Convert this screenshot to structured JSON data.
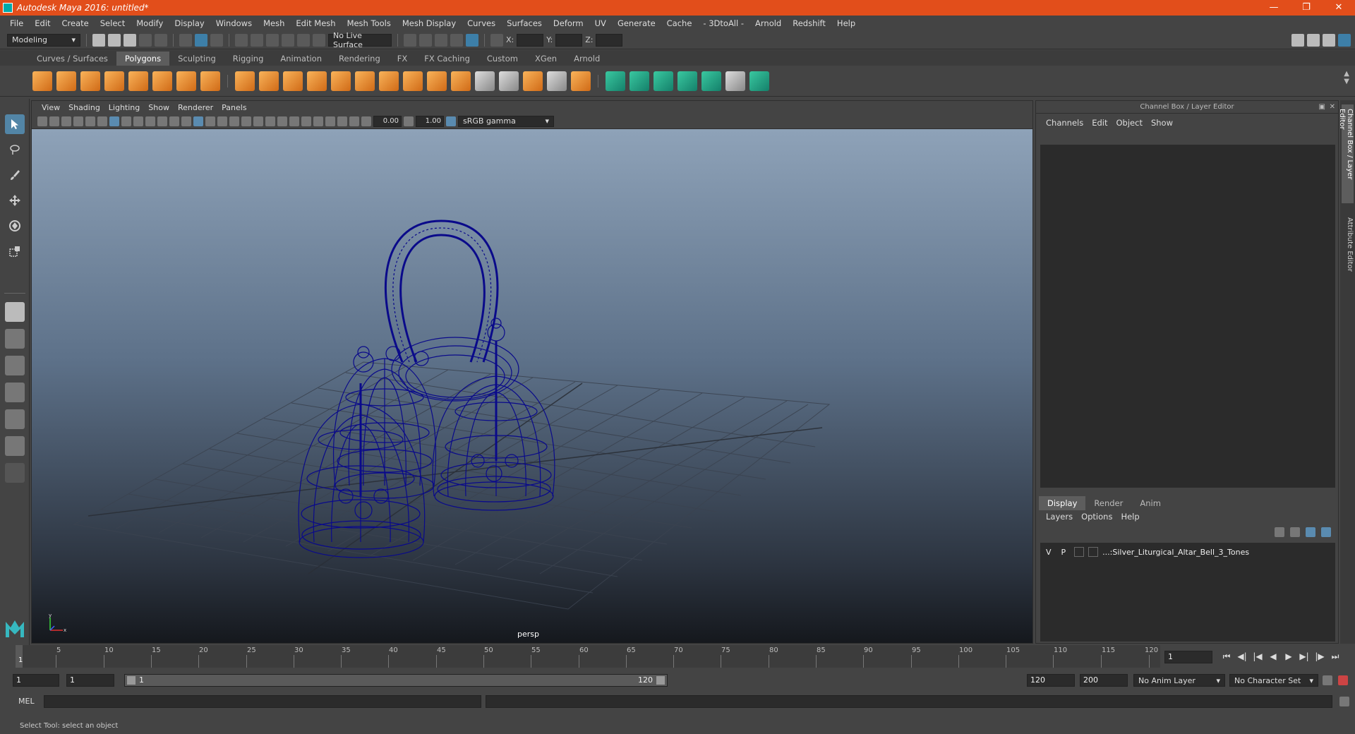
{
  "window": {
    "title": "Autodesk Maya 2016: untitled*"
  },
  "menubar": [
    "File",
    "Edit",
    "Create",
    "Select",
    "Modify",
    "Display",
    "Windows",
    "Mesh",
    "Edit Mesh",
    "Mesh Tools",
    "Mesh Display",
    "Curves",
    "Surfaces",
    "Deform",
    "UV",
    "Generate",
    "Cache",
    "- 3DtoAll -",
    "Arnold",
    "Redshift",
    "Help"
  ],
  "statusline": {
    "menuset": "Modeling",
    "live_surface": "No Live Surface",
    "x_label": "X:",
    "y_label": "Y:",
    "z_label": "Z:"
  },
  "shelf_tabs": [
    {
      "label": "Curves / Surfaces",
      "active": false
    },
    {
      "label": "Polygons",
      "active": true
    },
    {
      "label": "Sculpting",
      "active": false
    },
    {
      "label": "Rigging",
      "active": false
    },
    {
      "label": "Animation",
      "active": false
    },
    {
      "label": "Rendering",
      "active": false
    },
    {
      "label": "FX",
      "active": false
    },
    {
      "label": "FX Caching",
      "active": false
    },
    {
      "label": "Custom",
      "active": false
    },
    {
      "label": "XGen",
      "active": false
    },
    {
      "label": "Arnold",
      "active": false
    }
  ],
  "panel": {
    "menu": [
      "View",
      "Shading",
      "Lighting",
      "Show",
      "Renderer",
      "Panels"
    ],
    "exposure": "0.00",
    "gamma": "1.00",
    "colorspace": "sRGB gamma",
    "camera": "persp",
    "axis_y": "y",
    "axis_x": "x"
  },
  "channelbox": {
    "title": "Channel Box / Layer Editor",
    "menu": [
      "Channels",
      "Edit",
      "Object",
      "Show"
    ],
    "layer_tabs": [
      {
        "label": "Display",
        "active": true
      },
      {
        "label": "Render",
        "active": false
      },
      {
        "label": "Anim",
        "active": false
      }
    ],
    "layer_menu": [
      "Layers",
      "Options",
      "Help"
    ],
    "layer": {
      "v": "V",
      "p": "P",
      "name": "...:Silver_Liturgical_Altar_Bell_3_Tones"
    }
  },
  "side_tabs": [
    "Channel Box / Layer Editor",
    "Attribute Editor"
  ],
  "timeline": {
    "ticks": [
      "5",
      "10",
      "15",
      "20",
      "25",
      "30",
      "35",
      "40",
      "45",
      "50",
      "55",
      "60",
      "65",
      "70",
      "75",
      "80",
      "85",
      "90",
      "95",
      "100",
      "105",
      "110",
      "115",
      "120"
    ],
    "current_frame_label": "1",
    "current_frame": "1"
  },
  "range": {
    "start": "1",
    "playback_start": "1",
    "slider_start": "1",
    "slider_end": "120",
    "playback_end": "120",
    "end": "200",
    "anim_layer": "No Anim Layer",
    "character_set": "No Character Set"
  },
  "mel": {
    "label": "MEL"
  },
  "help": {
    "text": "Select Tool: select an object"
  },
  "colors": {
    "title_bar": "#e24e1b",
    "wireframe": "#0a0a8a",
    "selection": "#5285a6"
  }
}
